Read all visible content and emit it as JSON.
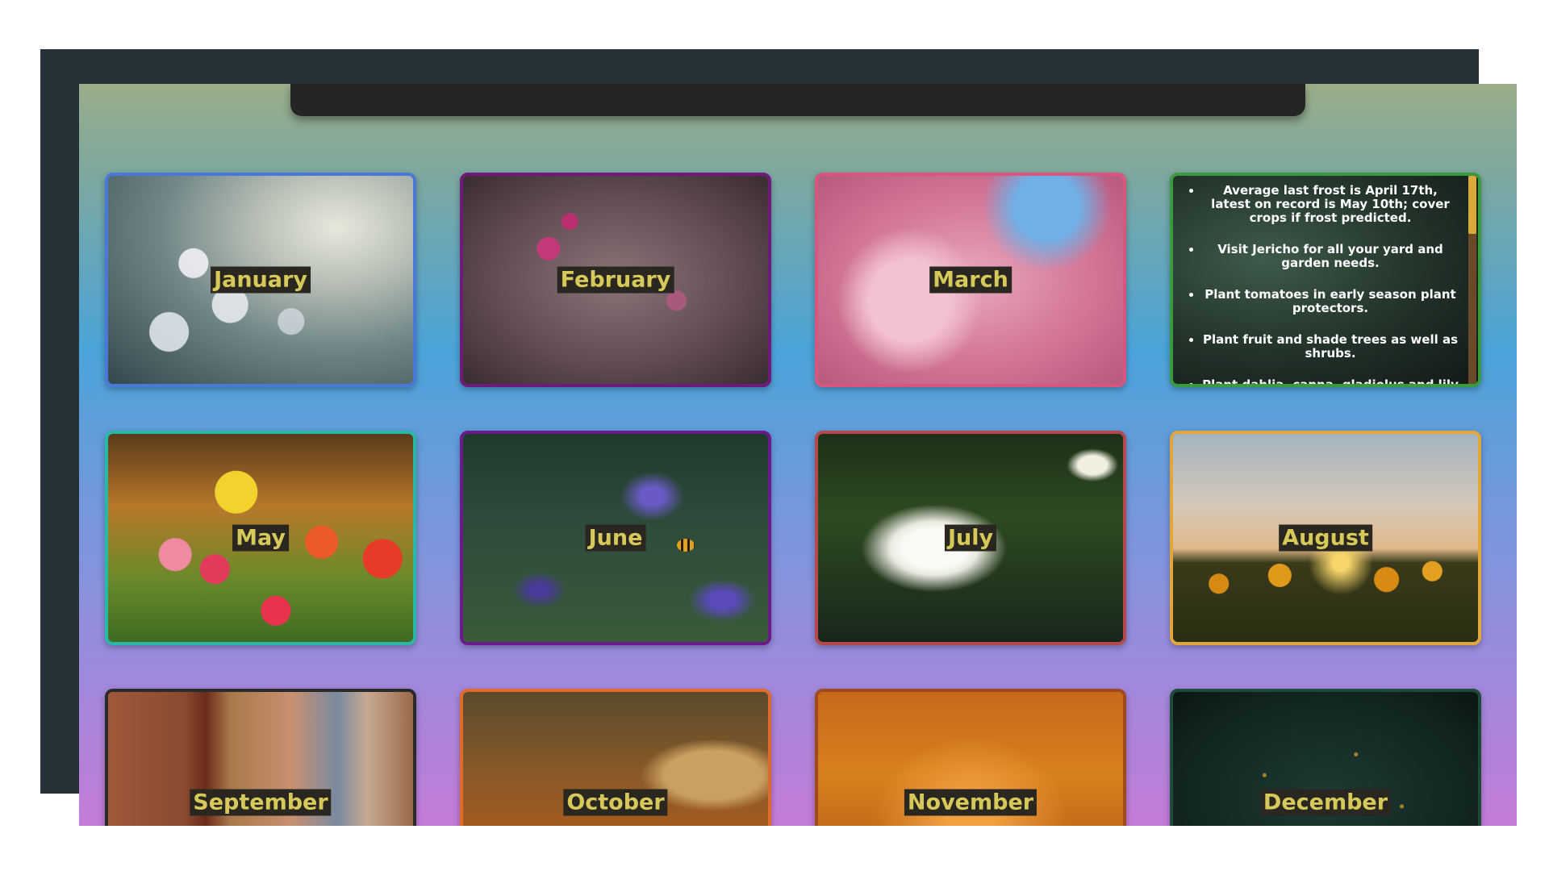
{
  "months": {
    "january": "January",
    "february": "February",
    "march": "March",
    "may": "May",
    "june": "June",
    "july": "July",
    "august": "August",
    "september": "September",
    "october": "October",
    "november": "November",
    "december": "December"
  },
  "april_tips": [
    "Average last frost is April 17th, latest on record is May 10th; cover crops if frost predicted.",
    "Visit Jericho for all your yard and garden needs.",
    "Plant tomatoes in early season plant protectors.",
    "Plant fruit and shade trees as well as shrubs.",
    "Plant dahlia, canna, gladiolus and lily"
  ],
  "colors": {
    "label_text": "#d6c95a",
    "label_bg": "#2a2620",
    "backdrop": "#263238",
    "topbar": "#252525"
  }
}
